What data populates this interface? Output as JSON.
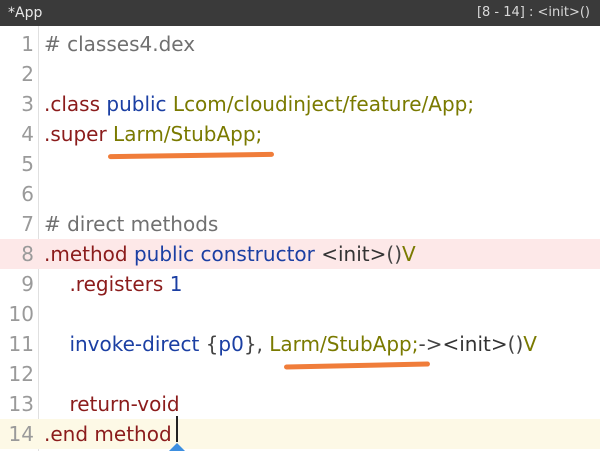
{
  "window": {
    "title": "*App",
    "position": "[8 - 14] : <init>()"
  },
  "lines": [
    {
      "n": "1",
      "tokens": [
        {
          "t": "# classes4.dex",
          "c": "c-comment"
        }
      ]
    },
    {
      "n": "2",
      "tokens": []
    },
    {
      "n": "3",
      "tokens": [
        {
          "t": ".class",
          "c": "c-directive"
        },
        {
          "t": " "
        },
        {
          "t": "public",
          "c": "c-keyword"
        },
        {
          "t": " "
        },
        {
          "t": "Lcom/cloudinject/feature/App;",
          "c": "c-type"
        }
      ]
    },
    {
      "n": "4",
      "tokens": [
        {
          "t": ".super",
          "c": "c-directive"
        },
        {
          "t": " "
        },
        {
          "t": "Larm/StubApp;",
          "c": "c-type"
        }
      ]
    },
    {
      "n": "5",
      "tokens": []
    },
    {
      "n": "6",
      "tokens": []
    },
    {
      "n": "7",
      "tokens": [
        {
          "t": "# direct methods",
          "c": "c-comment"
        }
      ]
    },
    {
      "n": "8",
      "tokens": [
        {
          "t": ".method",
          "c": "c-directive"
        },
        {
          "t": " "
        },
        {
          "t": "public",
          "c": "c-keyword"
        },
        {
          "t": " "
        },
        {
          "t": "constructor",
          "c": "c-keyword"
        },
        {
          "t": " "
        },
        {
          "t": "<init>",
          "c": "c-plain"
        },
        {
          "t": "()",
          "c": "c-op"
        },
        {
          "t": "V",
          "c": "c-type"
        }
      ]
    },
    {
      "n": "9",
      "tokens": [
        {
          "t": "    "
        },
        {
          "t": ".registers",
          "c": "c-directive"
        },
        {
          "t": " "
        },
        {
          "t": "1",
          "c": "c-number"
        }
      ]
    },
    {
      "n": "10",
      "tokens": []
    },
    {
      "n": "11",
      "tokens": [
        {
          "t": "    "
        },
        {
          "t": "invoke-direct",
          "c": "c-keyword"
        },
        {
          "t": " "
        },
        {
          "t": "{",
          "c": "c-op"
        },
        {
          "t": "p0",
          "c": "c-reg"
        },
        {
          "t": "},",
          "c": "c-op"
        },
        {
          "t": " "
        },
        {
          "t": "Larm/StubApp;",
          "c": "c-type"
        },
        {
          "t": "->",
          "c": "c-op"
        },
        {
          "t": "<init>",
          "c": "c-plain"
        },
        {
          "t": "()",
          "c": "c-op"
        },
        {
          "t": "V",
          "c": "c-type"
        }
      ]
    },
    {
      "n": "12",
      "tokens": []
    },
    {
      "n": "13",
      "tokens": [
        {
          "t": "    "
        },
        {
          "t": "return-void",
          "c": "c-directive"
        }
      ]
    },
    {
      "n": "14",
      "tokens": [
        {
          "t": ".end",
          "c": "c-directive"
        },
        {
          "t": " "
        },
        {
          "t": "method",
          "c": "c-directive"
        }
      ]
    }
  ],
  "colors": {
    "underline_annotation": "#f07d3a",
    "current_method_highlight": "#fde8e8",
    "cursor_line_highlight": "#fdf9e6"
  }
}
